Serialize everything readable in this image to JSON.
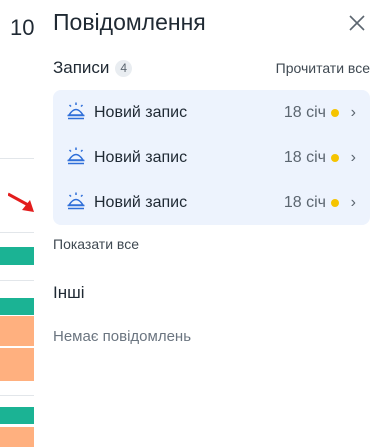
{
  "background": {
    "partial_number": "10",
    "colors": {
      "teal": "#1bb394",
      "orange": "#ffb07f",
      "arrow": "#e31d1d"
    }
  },
  "panel": {
    "title": "Повідомлення",
    "close_icon": "close-icon",
    "records_section": {
      "title": "Записи",
      "count": "4",
      "read_all": "Прочитати все",
      "items": [
        {
          "icon": "bell-icon",
          "title": "Новий запис",
          "date": "18 січ",
          "unread": true
        },
        {
          "icon": "bell-icon",
          "title": "Новий запис",
          "date": "18 січ",
          "unread": true
        },
        {
          "icon": "bell-icon",
          "title": "Новий запис",
          "date": "18 січ",
          "unread": true
        }
      ],
      "show_all": "Показати все"
    },
    "other_section": {
      "title": "Інші",
      "empty_text": "Немає повідомлень"
    },
    "colors": {
      "accent_bg": "#edf3fd",
      "icon_blue": "#2f6fd9",
      "unread_dot": "#f5c400"
    }
  }
}
